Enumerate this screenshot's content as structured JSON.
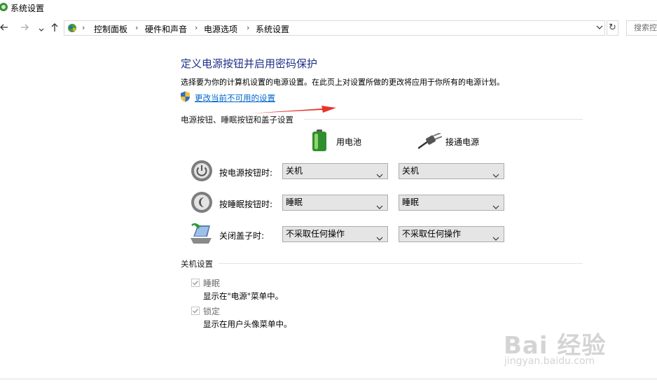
{
  "window": {
    "title": "系统设置",
    "icon": "control-panel-icon"
  },
  "nav": {
    "back_icon": "back-arrow-icon",
    "forward_icon": "forward-arrow-icon",
    "recent_icon": "chevron-down-icon",
    "up_icon": "up-arrow-icon",
    "breadcrumb": [
      "控制面板",
      "硬件和声音",
      "电源选项",
      "系统设置"
    ],
    "separator": "›",
    "refresh_icon": "refresh-icon",
    "search_placeholder": "搜索控制面板"
  },
  "page": {
    "title": "定义电源按钮并启用密码保护",
    "description": "选择要为你的计算机设置的电源设置。在此页上对设置所做的更改将应用于你所有的电源计划。",
    "change_link": "更改当前不可用的设置",
    "annotation_arrow_color": "#e8352b"
  },
  "power_section": {
    "heading": "电源按钮、睡眠按钮和盖子设置",
    "columns": [
      {
        "label": "用电池",
        "icon": "battery-icon"
      },
      {
        "label": "接通电源",
        "icon": "power-plug-icon"
      }
    ],
    "rows": [
      {
        "label": "按电源按钮时:",
        "icon": "power-button-icon",
        "battery": "关机",
        "plugged": "关机"
      },
      {
        "label": "按睡眠按钮时:",
        "icon": "sleep-button-icon",
        "battery": "睡眠",
        "plugged": "睡眠"
      },
      {
        "label": "关闭盖子时:",
        "icon": "laptop-lid-icon",
        "battery": "不采取任何操作",
        "plugged": "不采取任何操作"
      }
    ]
  },
  "shutdown_section": {
    "heading": "关机设置",
    "options": [
      {
        "label": "睡眠",
        "description": "显示在\"电源\"菜单中。",
        "checked": true,
        "disabled": true
      },
      {
        "label": "锁定",
        "description": "显示在用户头像菜单中。",
        "checked": true,
        "disabled": true
      }
    ]
  },
  "watermark": {
    "main": "Bai 经验",
    "sub": "jingyan.baidu.com"
  }
}
